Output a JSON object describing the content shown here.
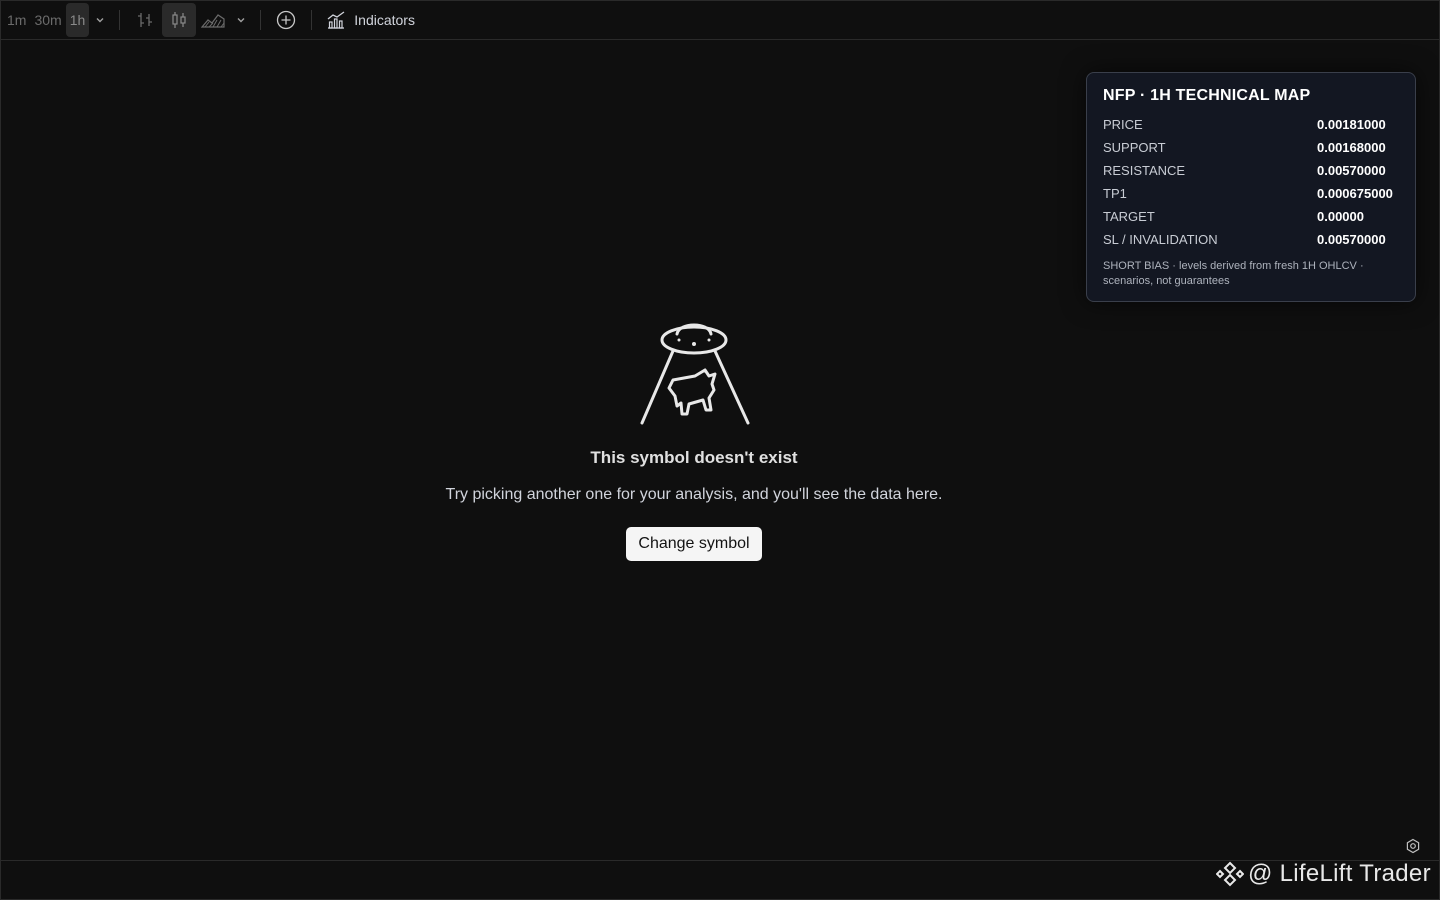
{
  "toolbar": {
    "intervals": [
      {
        "label": "1m",
        "active": false
      },
      {
        "label": "30m",
        "active": false
      },
      {
        "label": "1h",
        "active": true
      }
    ],
    "indicators_label": "Indicators"
  },
  "empty_state": {
    "title": "This symbol doesn't exist",
    "subtitle": "Try picking another one for your analysis, and you'll see the data here.",
    "button_label": "Change symbol"
  },
  "tech_map": {
    "title": "NFP · 1H TECHNICAL MAP",
    "rows": [
      {
        "label": "PRICE",
        "value": "0.00181000"
      },
      {
        "label": "SUPPORT",
        "value": "0.00168000"
      },
      {
        "label": "RESISTANCE",
        "value": "0.00570000"
      },
      {
        "label": "TP1",
        "value": "0.000675000"
      },
      {
        "label": "TARGET",
        "value": "0.00000"
      },
      {
        "label": "SL / INVALIDATION",
        "value": "0.00570000"
      }
    ],
    "note": "SHORT BIAS · levels derived from fresh 1H OHLCV · scenarios, not guarantees"
  },
  "watermark": {
    "text": "@ LifeLift Trader"
  },
  "colors": {
    "background": "#0f0f0f",
    "panel_bg": "#131722",
    "button_bg": "#f5f5f5"
  }
}
